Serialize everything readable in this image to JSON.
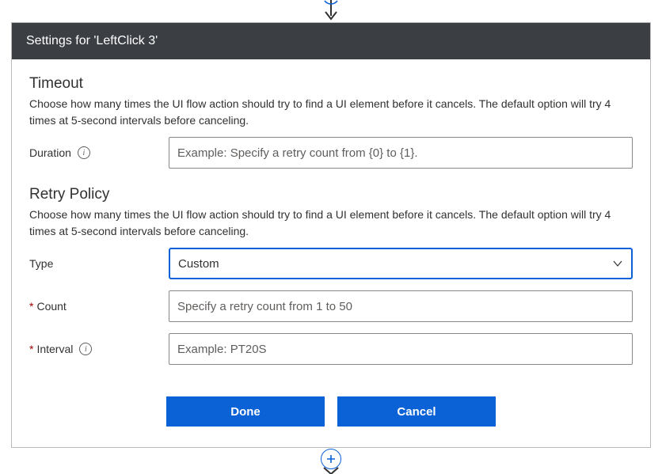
{
  "header": {
    "title": "Settings for 'LeftClick 3'"
  },
  "timeout": {
    "heading": "Timeout",
    "description": "Choose how many times the UI flow action should try to find a UI element before it cancels. The default option will try 4 times at 5-second intervals before canceling.",
    "duration_label": "Duration",
    "duration_placeholder": "Example: Specify a retry count from {0} to {1}.",
    "duration_value": ""
  },
  "retry": {
    "heading": "Retry Policy",
    "description": "Choose how many times the UI flow action should try to find a UI element before it cancels. The default option will try 4 times at 5-second intervals before canceling.",
    "type_label": "Type",
    "type_value": "Custom",
    "count_label": "Count",
    "count_placeholder": "Specify a retry count from 1 to 50",
    "count_value": "",
    "interval_label": "Interval",
    "interval_placeholder": "Example: PT20S",
    "interval_value": ""
  },
  "buttons": {
    "done": "Done",
    "cancel": "Cancel"
  }
}
